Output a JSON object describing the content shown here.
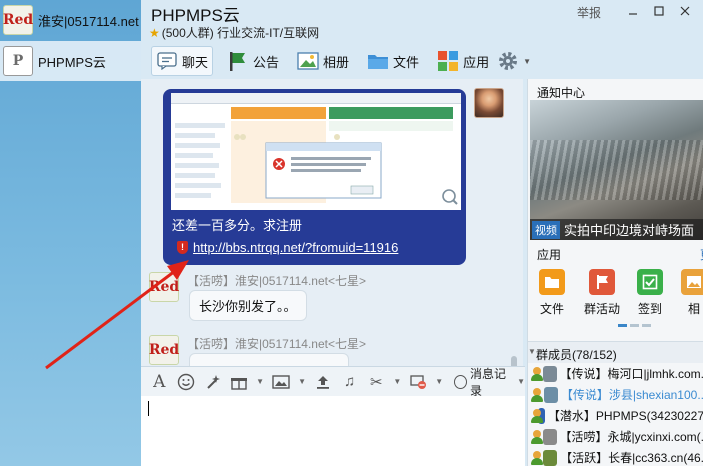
{
  "sessions": [
    {
      "name": "淮安|0517114.net",
      "avatar_text": "Red",
      "active": false
    },
    {
      "name": "PHPMPS云",
      "avatar_text": "P",
      "active": true
    }
  ],
  "group": {
    "title": "PHPMPS云",
    "subtitle": "(500人群) 行业交流-IT/互联网",
    "report": "举报"
  },
  "tabs": [
    {
      "label": "聊天",
      "icon": "chat-icon"
    },
    {
      "label": "公告",
      "icon": "announcement-icon"
    },
    {
      "label": "相册",
      "icon": "photo-icon"
    },
    {
      "label": "文件",
      "icon": "folder-icon"
    },
    {
      "label": "应用",
      "icon": "apps-icon"
    }
  ],
  "chat": {
    "self_message": {
      "text": "还差一百多分。求注册",
      "link": "http://bbs.ntrqq.net/?fromuid=11916"
    },
    "messages": [
      {
        "sender": "【活唠】淮安|0517114.net<七星>",
        "text": "长沙你别发了。。"
      },
      {
        "sender": "【活唠】淮安|0517114.net<七星>",
        "text": ""
      }
    ]
  },
  "toolbar": {
    "history_label": "消息记录"
  },
  "right": {
    "notice_title": "通知中心",
    "notice_tag": "视频",
    "notice_caption": "实拍中印边境对峙场面",
    "apps_title": "应用",
    "apps_more": "更",
    "apps": [
      {
        "label": "文件",
        "color": "#f29a1a",
        "icon": "folder-icon"
      },
      {
        "label": "群活动",
        "color": "#e0583a",
        "icon": "flag-icon"
      },
      {
        "label": "签到",
        "color": "#3ab04a",
        "icon": "check-icon"
      },
      {
        "label": "相",
        "color": "#e9a23b",
        "icon": "album-icon"
      }
    ],
    "members_title": "群成员(78/152)",
    "members": [
      {
        "text": "【传说】梅河口|jlmhk.com.",
        "highlight": false,
        "color": "#7b8a96"
      },
      {
        "text": "【传说】涉县|shexian100..",
        "highlight": true,
        "color": "#6c8ea6"
      },
      {
        "text": "【潜水】PHPMPS(34230227",
        "highlight": false,
        "color": "#2f62b3"
      },
      {
        "text": "【活唠】永城|ycxinxi.com(.",
        "highlight": false,
        "color": "#8a8a8a"
      },
      {
        "text": "【活跃】长春|cc363.cn(46.",
        "highlight": false,
        "color": "#6b8a3a"
      }
    ]
  }
}
